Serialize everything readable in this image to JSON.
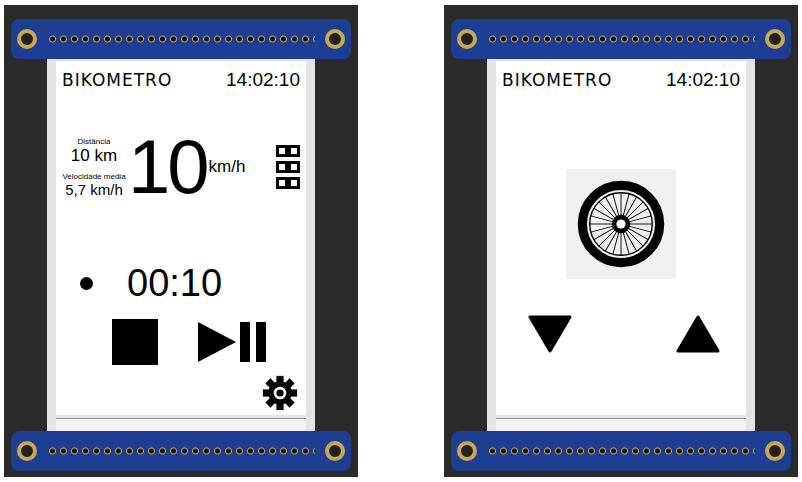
{
  "left_screen": {
    "logo": "BIKOMETRO",
    "time": "14:02:10",
    "distance_label": "Distância",
    "distance": "10 km",
    "avg_speed_label": "Velocidade media",
    "avg_speed": "5,7 km/h",
    "speed": "10",
    "speed_unit": "km/h",
    "recording": true,
    "timer": "00:10"
  },
  "right_screen": {
    "logo": "BIKOMETRO",
    "time": "14:02:10"
  }
}
